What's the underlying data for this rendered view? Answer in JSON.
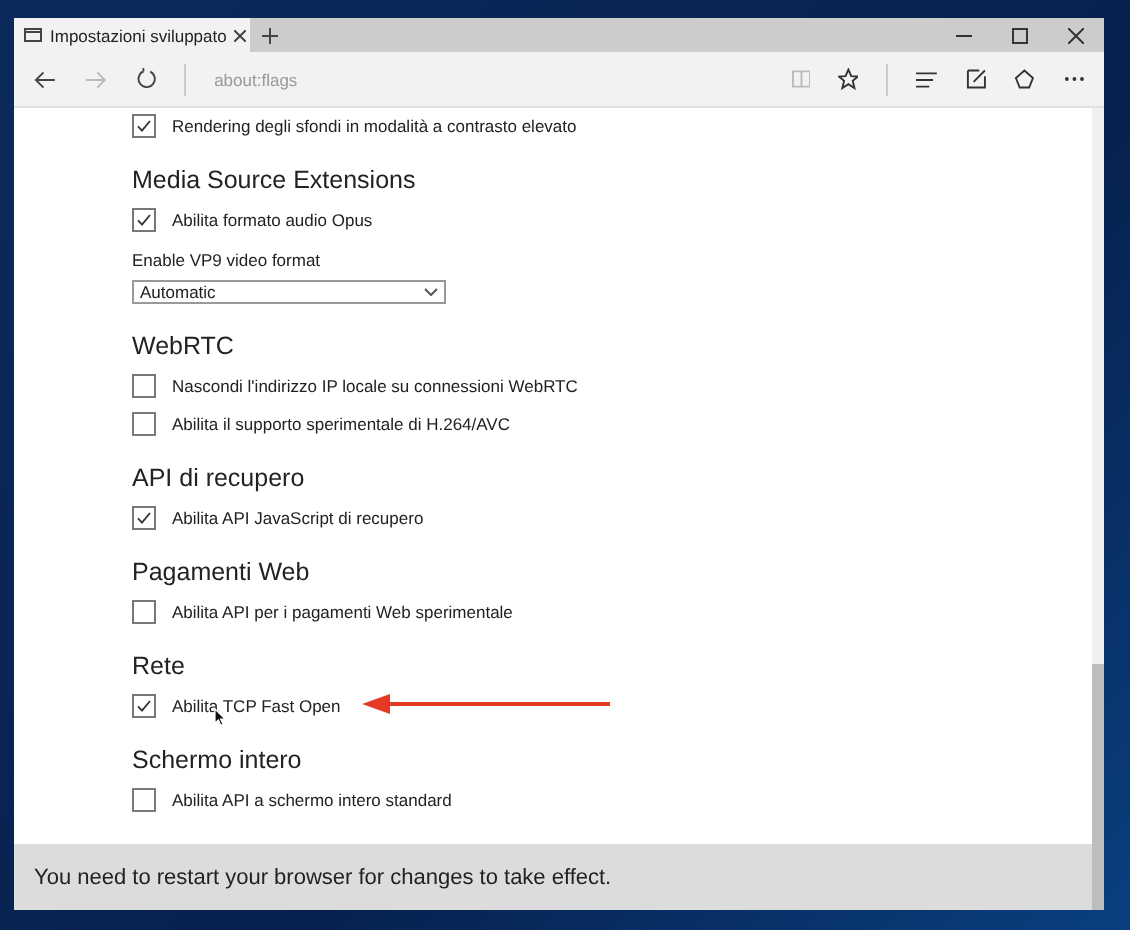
{
  "tab": {
    "title": "Impostazioni sviluppato"
  },
  "address": {
    "value": "about:flags"
  },
  "sections": [
    {
      "items": [
        {
          "kind": "checkbox",
          "label": "Rendering degli sfondi in modalità a contrasto elevato",
          "checked": true
        }
      ]
    },
    {
      "heading": "Media Source Extensions",
      "items": [
        {
          "kind": "checkbox",
          "label": "Abilita formato audio Opus",
          "checked": true
        },
        {
          "kind": "select",
          "label": "Enable VP9 video format",
          "value": "Automatic"
        }
      ]
    },
    {
      "heading": "WebRTC",
      "items": [
        {
          "kind": "checkbox",
          "label": "Nascondi l'indirizzo IP locale su connessioni WebRTC",
          "checked": false
        },
        {
          "kind": "checkbox",
          "label": "Abilita il supporto sperimentale di H.264/AVC",
          "checked": false
        }
      ]
    },
    {
      "heading": "API di recupero",
      "items": [
        {
          "kind": "checkbox",
          "label": "Abilita API JavaScript di recupero",
          "checked": true
        }
      ]
    },
    {
      "heading": "Pagamenti Web",
      "items": [
        {
          "kind": "checkbox",
          "label": "Abilita API per i pagamenti Web sperimentale",
          "checked": false
        }
      ]
    },
    {
      "heading": "Rete",
      "items": [
        {
          "kind": "checkbox",
          "label": "Abilita TCP Fast Open",
          "checked": true,
          "highlighted": true
        }
      ]
    },
    {
      "heading": "Schermo intero",
      "items": [
        {
          "kind": "checkbox",
          "label": "Abilita API a schermo intero standard",
          "checked": false
        }
      ]
    }
  ],
  "notification": "You need to restart your browser for changes to take effect."
}
